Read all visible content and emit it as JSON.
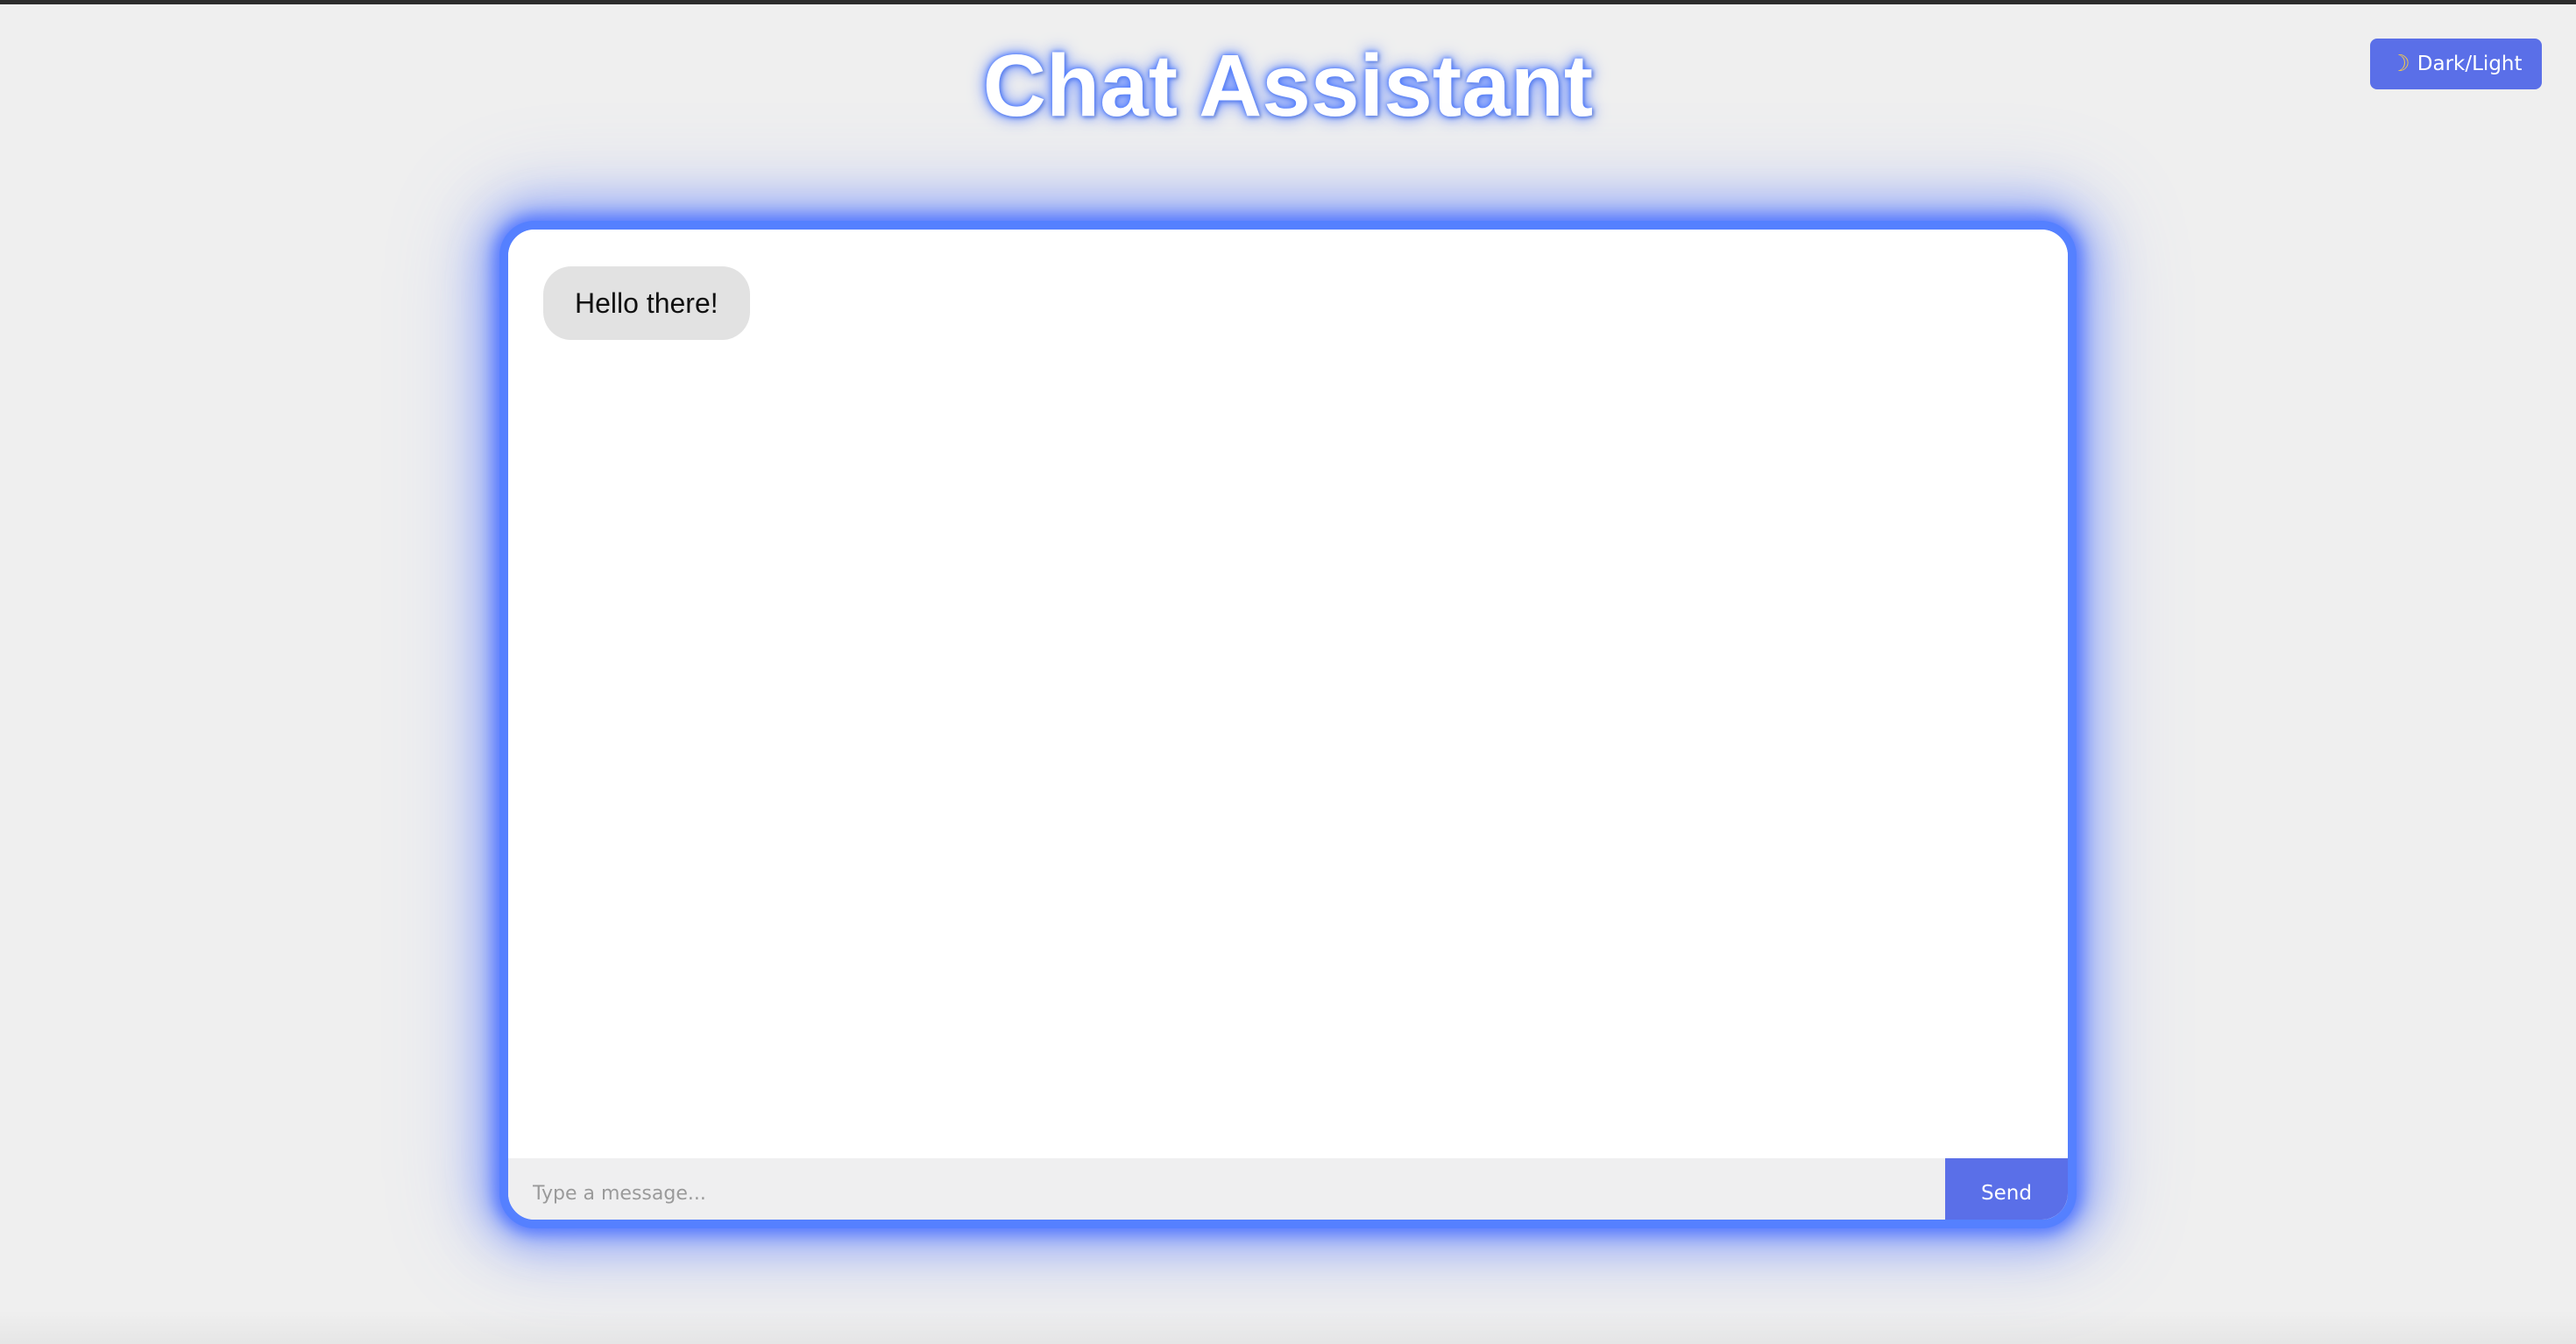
{
  "header": {
    "title": "Chat Assistant",
    "theme_toggle": {
      "icon": "moon-icon",
      "label": "Dark/Light"
    }
  },
  "chat": {
    "messages": [
      {
        "text": "Hello there!"
      }
    ],
    "input": {
      "value": "",
      "placeholder": "Type a message..."
    },
    "send_label": "Send"
  },
  "colors": {
    "accent": "#5a6fe8",
    "glow_border": "#5580ff",
    "background": "#efefef",
    "bubble": "#e2e2e2"
  }
}
